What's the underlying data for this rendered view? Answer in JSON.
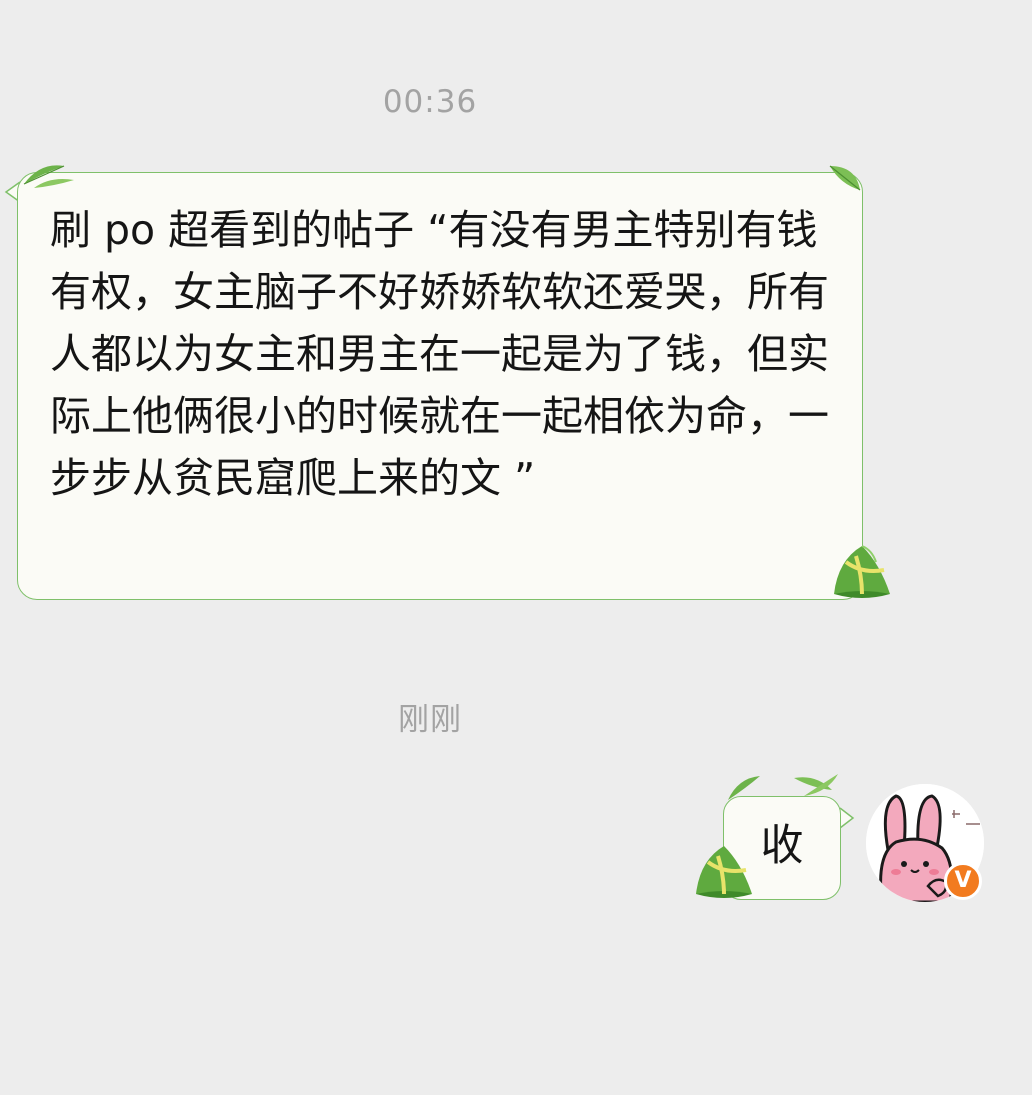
{
  "chat": {
    "timestamps": [
      "00:36",
      "刚刚"
    ],
    "incoming_message": "刷 po 超看到的帖子 “有没有男主特别有钱有权，女主脑子不好娇娇软软还爱哭，所有人都以为女主和男主在一起是为了钱，但实际上他俩很小的时候就在一起相依为命，一步步从贫民窟爬上来的文 ”",
    "outgoing_message": "收",
    "avatar": {
      "icon": "pink-bunny-avatar",
      "badge": "V",
      "badge_color": "#f27b1f"
    }
  },
  "theme": {
    "background": "#ededed",
    "bubble_fill": "#fbfbf6",
    "bubble_border": "#7fc06a"
  }
}
